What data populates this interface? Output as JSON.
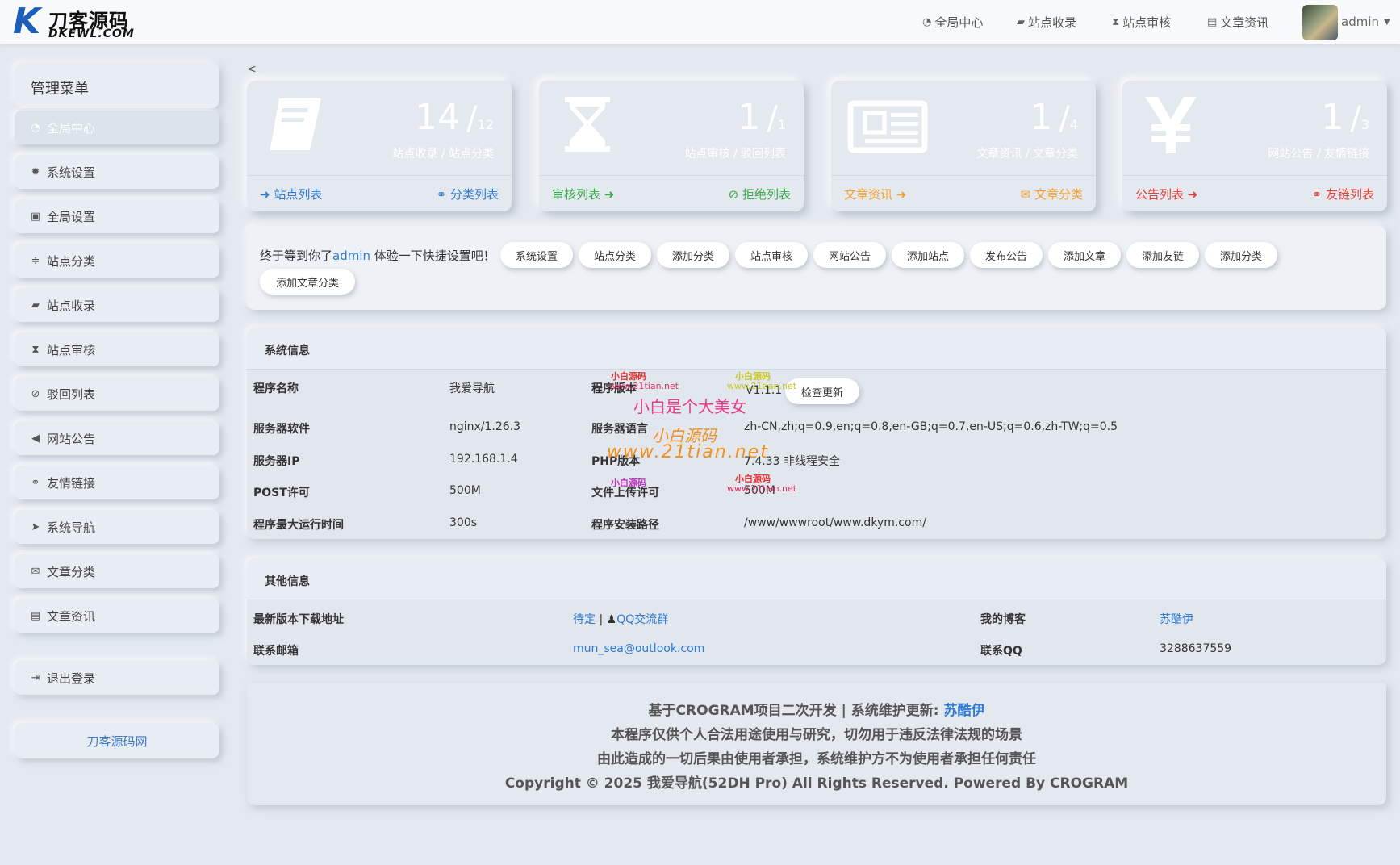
{
  "header": {
    "logo_cn": "刀客源码",
    "logo_en": "DKEWL.COM",
    "nav": [
      {
        "label": "全局中心",
        "icon": "dashboard-icon"
      },
      {
        "label": "站点收录",
        "icon": "book-icon"
      },
      {
        "label": "站点审核",
        "icon": "hourglass-icon"
      },
      {
        "label": "文章资讯",
        "icon": "newspaper-icon"
      }
    ],
    "user": "admin"
  },
  "sidebar": {
    "title": "管理菜单",
    "items": [
      {
        "label": "全局中心",
        "icon": "dashboard-icon"
      },
      {
        "label": "系统设置",
        "icon": "gear-icon"
      },
      {
        "label": "全局设置",
        "icon": "image-icon"
      },
      {
        "label": "站点分类",
        "icon": "sort-icon"
      },
      {
        "label": "站点收录",
        "icon": "book-icon"
      },
      {
        "label": "站点审核",
        "icon": "hourglass-icon"
      },
      {
        "label": "驳回列表",
        "icon": "ban-icon"
      },
      {
        "label": "网站公告",
        "icon": "bullhorn-icon"
      },
      {
        "label": "友情链接",
        "icon": "handshake-icon"
      },
      {
        "label": "系统导航",
        "icon": "location-arrow-icon"
      },
      {
        "label": "文章分类",
        "icon": "envelope-icon"
      },
      {
        "label": "文章资讯",
        "icon": "newspaper-icon"
      }
    ],
    "logout": "退出登录",
    "footer_link": "刀客源码网"
  },
  "back_arrow": "<",
  "cards": [
    {
      "main": "14",
      "sub": "12",
      "desc": "站点收录 / 站点分类",
      "left_link": "站点列表",
      "right_link": "分类列表",
      "color": "#2e7bd0"
    },
    {
      "main": "1",
      "sub": "1",
      "desc": "站点审核 / 驳回列表",
      "left_link": "审核列表",
      "right_link": "拒绝列表",
      "color": "#3aa84a"
    },
    {
      "main": "1",
      "sub": "4",
      "desc": "文章资讯 / 文章分类",
      "left_link": "文章资讯",
      "right_link": "文章分类",
      "color": "#f0a030"
    },
    {
      "main": "1",
      "sub": "3",
      "desc": "网站公告 / 友情链接",
      "left_link": "公告列表",
      "right_link": "友链列表",
      "color": "#e0443a"
    }
  ],
  "quick": {
    "greet_pre": "终于等到你了",
    "greet_user": "admin",
    "greet_post": " 体验一下快捷设置吧！",
    "buttons": [
      "系统设置",
      "站点分类",
      "添加分类",
      "站点审核",
      "网站公告",
      "添加站点",
      "发布公告",
      "添加文章",
      "添加友链",
      "添加分类",
      "添加文章分类"
    ]
  },
  "sysinfo": {
    "title": "系统信息",
    "rows": [
      {
        "k1": "程序名称",
        "v1": "我爱导航",
        "k2": "程序版本",
        "v2": "V1.1.1"
      },
      {
        "k1": "服务器软件",
        "v1": "nginx/1.26.3",
        "k2": "服务器语言",
        "v2": "zh-CN,zh;q=0.9,en;q=0.8,en-GB;q=0.7,en-US;q=0.6,zh-TW;q=0.5"
      },
      {
        "k1": "服务器IP",
        "v1": "192.168.1.4",
        "k2": "PHP版本",
        "v2": "7.4.33 非线程安全"
      },
      {
        "k1": "POST许可",
        "v1": "500M",
        "k2": "文件上传许可",
        "v2": "500M"
      },
      {
        "k1": "程序最大运行时间",
        "v1": "300s",
        "k2": "程序安装路径",
        "v2": "/www/wwwroot/www.dkym.com/"
      }
    ],
    "check_update": "检查更新"
  },
  "watermarks": {
    "small_red": "小白源码",
    "small_url": "www.21tian.net",
    "pink": "小白是个大美女",
    "orange_cn": "小白源码",
    "orange_url": "www.21tian.net"
  },
  "otherinfo": {
    "title": "其他信息",
    "download_label": "最新版本下载地址",
    "download_pending": "待定",
    "download_sep": " | ",
    "qq_group": "QQ交流群",
    "blog_label": "我的博客",
    "blog_value": "苏酷伊",
    "email_label": "联系邮箱",
    "email_value": "mun_sea@outlook.com",
    "qq_label": "联系QQ",
    "qq_value": "3288637559"
  },
  "footer": {
    "line1_pre": "基于CROGRAM项目二次开发 | 系统维护更新: ",
    "line1_name": "苏酷伊",
    "line2": "本程序仅供个人合法用途使用与研究，切勿用于违反法律法规的场景",
    "line3": "由此造成的一切后果由使用者承担，系统维护方不为使用者承担任何责任",
    "line4": "Copyright © 2025 我爱导航(52DH Pro) All Rights Reserved. Powered By CROGRAM"
  }
}
